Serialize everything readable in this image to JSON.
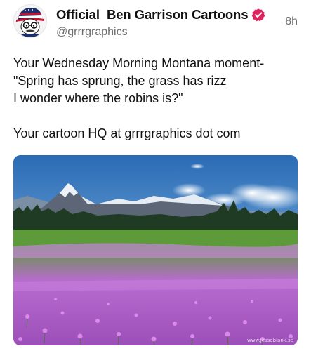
{
  "post": {
    "display_name": "Official  Ben Garrison Cartoons",
    "handle": "@grrrgraphics",
    "timestamp": "8h",
    "lines": [
      "Your Wednesday Morning Montana moment-",
      "\"Spring has sprung, the grass has rizz",
      "I wonder where the robins is?\"",
      "",
      "Your cartoon HQ at grrrgraphics dot com"
    ],
    "media_watermark": "www.jesseblank.se"
  },
  "icons": {
    "avatar": "cartoon-avatar-icon",
    "verified": "verified-badge-icon"
  },
  "colors": {
    "verified_badge": "#e0245e",
    "text": "#111111",
    "muted": "#6e6e6e"
  }
}
